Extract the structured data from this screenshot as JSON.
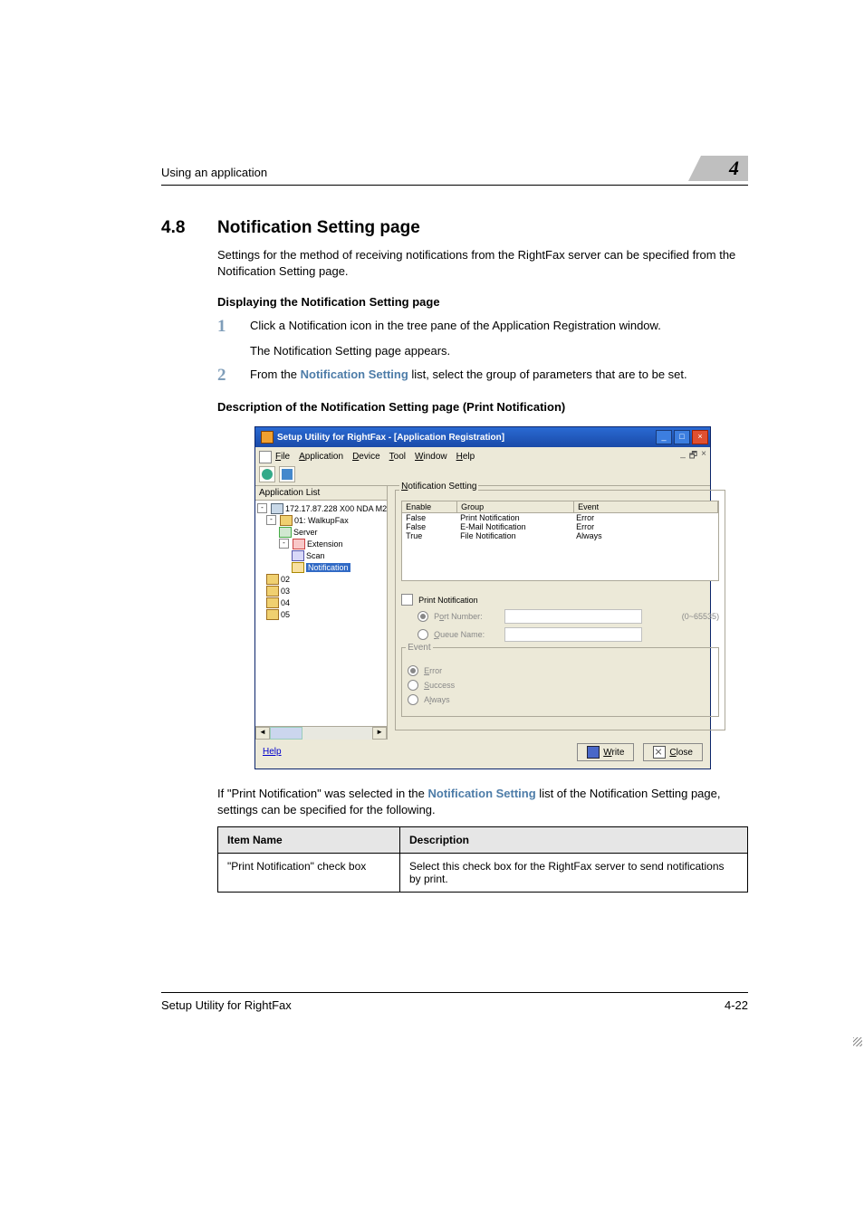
{
  "running_title": "Using an application",
  "chapter": "4",
  "section_num": "4.8",
  "section_title": "Notification Setting page",
  "intro": "Settings for the method of receiving notifications from the RightFax server can be specified from the Notification Setting page.",
  "h3_display": "Displaying the Notification Setting page",
  "step1": "Click a Notification icon in the tree pane of the Application Registration window.",
  "step1_sub": "The Notification Setting page appears.",
  "step2_pre": "From the ",
  "step2_link": "Notification Setting",
  "step2_post": " list, select the group of parameters that are to be set.",
  "h3_desc": "Description of the Notification Setting page (Print Notification)",
  "after_img_pre": "If \"Print Notification\" was selected in the ",
  "after_img_link": "Notification Setting",
  "after_img_post": " list of the Notification Setting page, settings can be specified for the following.",
  "table": {
    "h1": "Item Name",
    "h2": "Description",
    "r1c1": "\"Print Notification\" check box",
    "r1c2": "Select this check box for the RightFax server to send notifications by print."
  },
  "footer_left": "Setup Utility for RightFax",
  "footer_right": "4-22",
  "app": {
    "title": "Setup Utility for RightFax - [Application Registration]",
    "menu": {
      "file": "File",
      "app": "Application",
      "device": "Device",
      "tool": "Tool",
      "window": "Window",
      "help": "Help"
    },
    "pane_label": "Application List",
    "tree": {
      "root": "172.17.87.228 X00 NDA M2",
      "n01": "01: WalkupFax",
      "server": "Server",
      "extension": "Extension",
      "scan": "Scan",
      "notification": "Notification",
      "n02": "02",
      "n03": "03",
      "n04": "04",
      "n05": "05"
    },
    "group_label": "Notification Setting",
    "cols": {
      "enable": "Enable",
      "group": "Group",
      "event": "Event"
    },
    "rows": [
      {
        "en": "False",
        "gr": "Print Notification",
        "ev": "Error"
      },
      {
        "en": "False",
        "gr": "E-Mail Notification",
        "ev": "Error"
      },
      {
        "en": "True",
        "gr": "File Notification",
        "ev": "Always"
      }
    ],
    "print_chk": "Print Notification",
    "port_radio": "Port Number:",
    "queue_radio": "Queue Name:",
    "range": "(0~65535)",
    "event_box": "Event",
    "ev_error": "Error",
    "ev_success": "Success",
    "ev_always": "Always",
    "help": "Help",
    "write": "Write",
    "close": "Close"
  }
}
